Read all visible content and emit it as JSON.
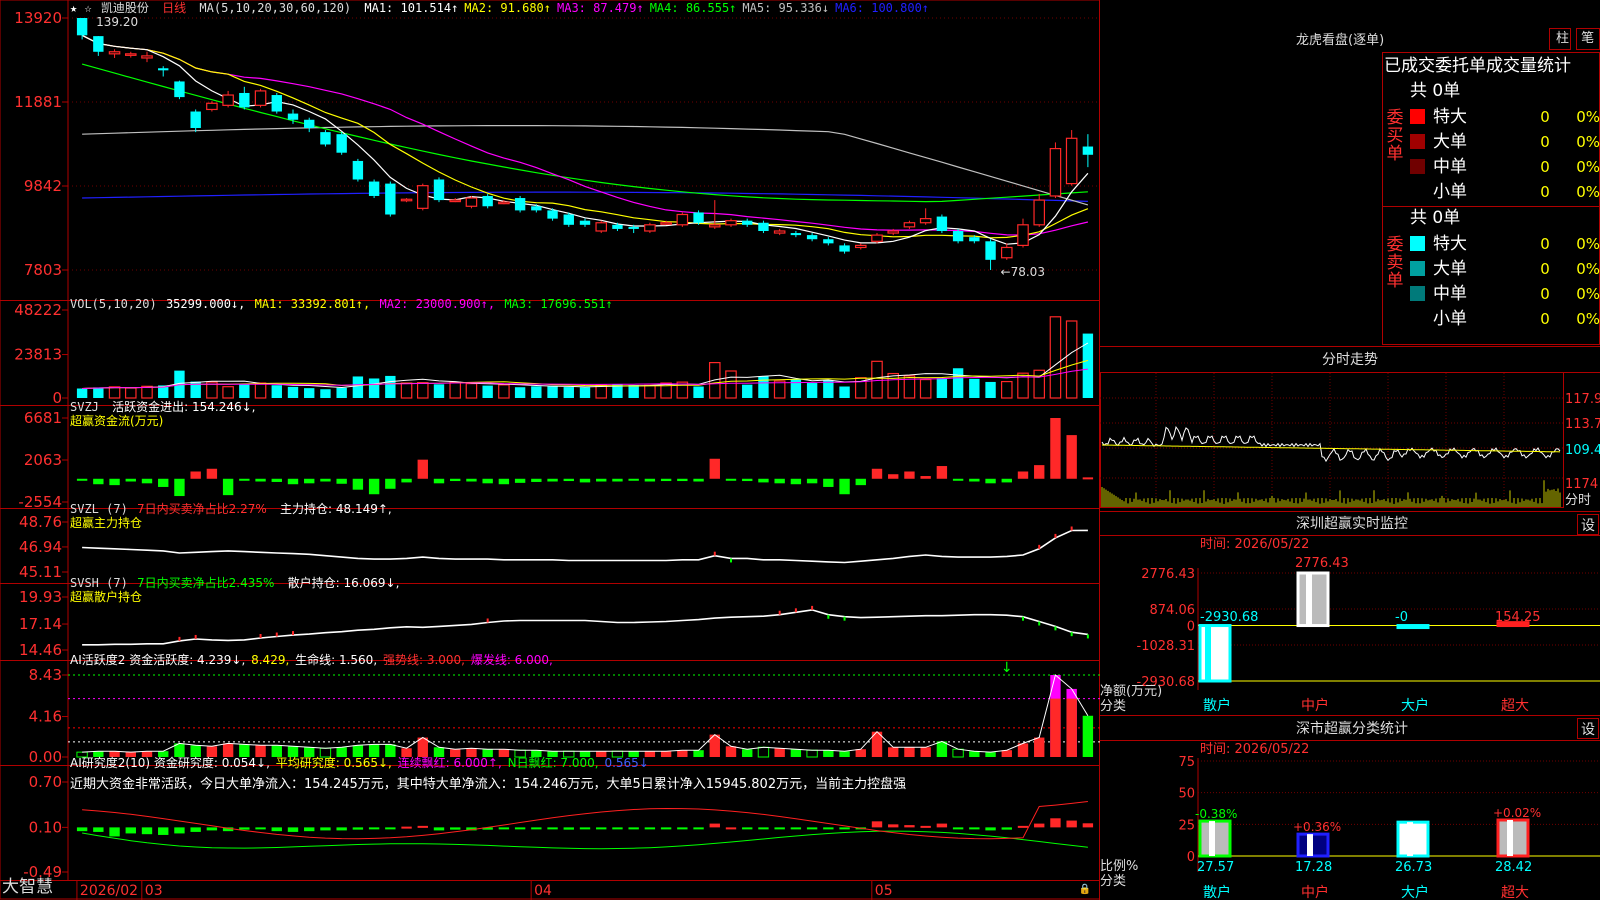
{
  "stock": {
    "name": "凯迪股份",
    "period": "日线",
    "top_marks": "★ ☆"
  },
  "colors": {
    "up": "#ff2828",
    "down": "#00ffff",
    "ma1": "#ffffff",
    "ma2": "#ffff00",
    "ma3": "#ff00ff",
    "ma4": "#00ff00",
    "ma5": "#c0c0c0",
    "ma6": "#2020ff",
    "frame": "#b00000",
    "grid": "#700000"
  },
  "main": {
    "ma_label": "MA(5,10,20,30,60,120)",
    "ma_items": [
      {
        "text": "MA1: 101.514↑",
        "color": "#ffffff"
      },
      {
        "text": "MA2: 91.680↑",
        "color": "#ffff00"
      },
      {
        "text": "MA3: 87.479↑",
        "color": "#ff00ff"
      },
      {
        "text": "MA4: 86.555↑",
        "color": "#00ff00"
      },
      {
        "text": "MA5: 95.336↓",
        "color": "#c0c0c0"
      },
      {
        "text": "MA6: 100.800↑",
        "color": "#2020ff"
      }
    ],
    "y_ticks": [
      "13920",
      "11881",
      "9842",
      "7803"
    ],
    "high_label": "139.20",
    "low_label": "←78.03"
  },
  "vol": {
    "label": "VOL(5,10,20)",
    "value": "35299.000↓,",
    "ma1": "MA1: 33392.801↑,",
    "ma2": "MA2: 23000.900↑,",
    "ma3": "MA3: 17696.551↑",
    "y_ticks": [
      "48222",
      "23813",
      "0"
    ]
  },
  "svzj": {
    "label": "SVZJ",
    "text": "活跃资金进出: 154.246↓,",
    "sub": "超赢资金流(万元)",
    "y_ticks": [
      "6681",
      "2063",
      "-2554"
    ]
  },
  "svzl": {
    "label": "SVZL (7)",
    "text1": "7日内买卖净占比2.27%",
    "text2": "主力持仓: 48.149↑,",
    "sub": "超赢主力持仓",
    "y_ticks": [
      "48.76",
      "46.94",
      "45.11"
    ]
  },
  "svsh": {
    "label": "SVSH (7)",
    "text1": "7日内买卖净占比2.435%",
    "text2": "散户持仓: 16.069↓,",
    "sub": "超赢散户持仓",
    "y_ticks": [
      "19.93",
      "17.14",
      "14.46"
    ]
  },
  "ai1": {
    "label": "AI活跃度2 资金活跃度: 4.239↓,",
    "v2": "8.429,",
    "v3": "生命线: 1.560,",
    "v4": "强势线: 3.000,",
    "v5": "爆发线: 6.000,",
    "y_ticks": [
      "8.43",
      "4.16",
      "0.00"
    ]
  },
  "ai2": {
    "label": "AI研究度2(10) 资金研究度: 0.054↓,",
    "v2": "平均研究度: 0.565↓,",
    "v3": "连续飘红: 6.000↑,",
    "v4": "N日飘红: 7.000,",
    "v5": "0.565↓",
    "text": "近期大资金非常活跃，今日大单净流入：154.245万元，其中特大单净流入：154.246万元，大单5日累计净入15945.802万元，当前主力控盘强",
    "y_ticks": [
      "0.70",
      "0.10",
      "-0.49"
    ]
  },
  "bottom": {
    "logo": "大智慧",
    "dates": [
      "2026/02",
      "03",
      "04",
      "05"
    ]
  },
  "dragon": {
    "title": "龙虎看盘(逐单)",
    "tab1": "柱",
    "tab2": "笔",
    "header": "已成交委托单成交量统计",
    "buy_label": "委买单",
    "sell_label": "委卖单",
    "buy_total": "共 0单",
    "sell_total": "共 0单",
    "buy_rows": [
      {
        "name": "特大",
        "val": "0",
        "pct": "0%",
        "color": "#ff0000"
      },
      {
        "name": "大单",
        "val": "0",
        "pct": "0%",
        "color": "#a00000"
      },
      {
        "name": "中单",
        "val": "0",
        "pct": "0%",
        "color": "#700000"
      },
      {
        "name": "小单",
        "val": "0",
        "pct": "0%",
        "color": ""
      }
    ],
    "sell_rows": [
      {
        "name": "特大",
        "val": "0",
        "pct": "0%",
        "color": "#00ffff"
      },
      {
        "name": "大单",
        "val": "0",
        "pct": "0%",
        "color": "#00a0a0"
      },
      {
        "name": "中单",
        "val": "0",
        "pct": "0%",
        "color": "#007a7a"
      },
      {
        "name": "小单",
        "val": "0",
        "pct": "0%",
        "color": ""
      }
    ]
  },
  "intraday": {
    "title": "分时走势",
    "ticks": [
      "117.9",
      "113.7",
      "109.4"
    ],
    "vol_tick": "1174",
    "unit": "分时"
  },
  "monitor": {
    "title": "深圳超赢实时监控",
    "btn": "设",
    "time": "时间: 2026/05/22",
    "y_ticks": [
      "2776.43",
      "874.06",
      "0",
      "-1028.31",
      "-2930.68"
    ],
    "unit1": "净额(万元)",
    "unit2": "分类",
    "categories": [
      "散户",
      "中户",
      "大户",
      "超大"
    ],
    "values": [
      -2930.68,
      2776.43,
      0,
      154.25
    ],
    "value_labels": [
      "-2930.68",
      "2776.43",
      "-0",
      "154.25"
    ]
  },
  "classify": {
    "title": "深市超赢分类统计",
    "btn": "设",
    "time": "时间: 2026/05/22",
    "y_ticks": [
      "75",
      "50",
      "25",
      "0"
    ],
    "unit1": "比例%",
    "unit2": "分类",
    "categories": [
      "散户",
      "中户",
      "大户",
      "超大"
    ],
    "values": [
      27.57,
      17.28,
      26.73,
      28.42
    ],
    "top_labels": [
      "-0.38%",
      "+0.36%",
      "",
      "+0.02%"
    ],
    "value_labels": [
      "27.57",
      "17.28",
      "26.73",
      "28.42"
    ]
  },
  "chart_data": [
    {
      "type": "candlestick",
      "title": "凯迪股份 日线",
      "ylim": [
        78.03,
        139.2
      ],
      "x_ticks": [
        "2026/02",
        "03",
        "04",
        "05"
      ],
      "ohlc": [
        [
          139.2,
          135.0,
          138.0,
          134.0
        ],
        [
          134.8,
          131.0,
          134.8,
          130.0
        ],
        [
          130.5,
          131.0,
          131.6,
          129.5
        ],
        [
          130.5,
          130.5,
          131.0,
          129.6
        ],
        [
          129.5,
          130.0,
          131.0,
          128.5
        ],
        [
          127.0,
          126.5,
          127.5,
          125.0
        ],
        [
          123.8,
          120.0,
          124.0,
          119.5
        ],
        [
          116.5,
          112.5,
          117.0,
          111.5
        ],
        [
          117.0,
          118.5,
          119.0,
          116.5
        ],
        [
          118.0,
          120.5,
          121.5,
          117.5
        ],
        [
          121.0,
          117.5,
          122.5,
          117.0
        ],
        [
          118.0,
          121.5,
          122.0,
          117.5
        ],
        [
          120.5,
          116.5,
          121.0,
          116.0
        ],
        [
          116.0,
          114.5,
          117.0,
          113.5
        ],
        [
          114.5,
          112.5,
          115.0,
          111.5
        ],
        [
          111.5,
          108.5,
          112.0,
          108.0
        ],
        [
          111.0,
          106.5,
          111.5,
          106.0
        ],
        [
          104.5,
          100.0,
          105.0,
          99.5
        ],
        [
          99.5,
          96.0,
          100.0,
          95.5
        ],
        [
          99.0,
          91.5,
          99.5,
          91.0
        ],
        [
          95.0,
          95.2,
          95.5,
          94.5
        ],
        [
          93.0,
          98.5,
          99.0,
          92.5
        ],
        [
          100.0,
          95.0,
          100.5,
          94.5
        ],
        [
          95.0,
          95.0,
          95.5,
          94.5
        ],
        [
          93.5,
          95.5,
          96.0,
          93.0
        ],
        [
          96.0,
          93.5,
          96.5,
          93.0
        ],
        [
          94.5,
          94.5,
          95.0,
          94.0
        ],
        [
          95.5,
          92.5,
          96.0,
          92.0
        ],
        [
          93.5,
          92.5,
          94.0,
          92.0
        ],
        [
          92.5,
          90.5,
          93.0,
          90.0
        ],
        [
          91.5,
          89.0,
          92.0,
          88.5
        ],
        [
          90.0,
          89.0,
          90.5,
          88.5
        ],
        [
          87.5,
          89.5,
          90.0,
          87.0
        ],
        [
          89.0,
          88.0,
          89.5,
          87.5
        ],
        [
          88.5,
          88.0,
          89.0,
          87.0
        ],
        [
          87.5,
          89.0,
          89.5,
          87.0
        ],
        [
          89.5,
          89.5,
          90.0,
          89.0
        ],
        [
          89.0,
          91.5,
          92.0,
          88.5
        ],
        [
          92.0,
          89.5,
          92.5,
          89.0
        ],
        [
          88.5,
          89.0,
          95.0,
          88.0
        ],
        [
          89.0,
          90.0,
          90.5,
          88.5
        ],
        [
          90.0,
          89.0,
          90.5,
          88.5
        ],
        [
          89.5,
          87.5,
          90.0,
          87.0
        ],
        [
          87.0,
          87.5,
          88.0,
          86.5
        ],
        [
          87.0,
          86.5,
          87.5,
          86.0
        ],
        [
          86.5,
          85.5,
          87.0,
          85.0
        ],
        [
          85.5,
          84.5,
          86.0,
          84.0
        ],
        [
          84.0,
          82.5,
          84.5,
          82.0
        ],
        [
          83.5,
          84.0,
          84.5,
          83.0
        ],
        [
          85.0,
          86.5,
          87.0,
          84.5
        ],
        [
          87.0,
          87.5,
          88.0,
          86.5
        ],
        [
          88.5,
          89.5,
          90.0,
          88.0
        ],
        [
          89.5,
          90.5,
          93.0,
          89.0
        ],
        [
          91.0,
          87.5,
          91.5,
          87.0
        ],
        [
          87.5,
          85.0,
          88.0,
          84.5
        ],
        [
          86.0,
          85.0,
          86.5,
          84.5
        ],
        [
          85.0,
          80.5,
          85.5,
          78.03
        ],
        [
          81.0,
          83.5,
          84.5,
          80.5
        ],
        [
          84.0,
          89.0,
          90.5,
          83.5
        ],
        [
          89.0,
          95.0,
          96.5,
          88.5
        ],
        [
          96.0,
          107.5,
          109.0,
          95.5
        ],
        [
          99.0,
          110.0,
          112.0,
          98.5
        ],
        [
          108.0,
          106.0,
          111.0,
          103.0
        ]
      ]
    },
    {
      "type": "bar",
      "title": "VOL(5,10,20)",
      "ylim": [
        0,
        48222
      ],
      "values": [
        5200,
        5800,
        6100,
        5500,
        6400,
        6900,
        15000,
        9000,
        8700,
        6200,
        7500,
        8200,
        7000,
        6100,
        5400,
        4800,
        5600,
        11800,
        10700,
        12100,
        8200,
        8400,
        7500,
        8600,
        7900,
        6800,
        7200,
        5900,
        6400,
        6300,
        6000,
        5900,
        7000,
        7400,
        7100,
        6900,
        8200,
        8700,
        6300,
        19400,
        14800,
        7300,
        11800,
        9300,
        10400,
        8200,
        9600,
        6300,
        11100,
        20100,
        13400,
        12100,
        10100,
        10900,
        16300,
        10500,
        8800,
        9000,
        13600,
        15200,
        44500,
        42200,
        35299
      ]
    },
    {
      "type": "bar",
      "title": "SVZJ 超赢资金流(万元)",
      "ylim": [
        -2554,
        6681
      ],
      "values": [
        -150,
        -600,
        -700,
        -300,
        -500,
        -900,
        -1900,
        800,
        1100,
        -1800,
        -200,
        -300,
        -350,
        -600,
        -500,
        -300,
        -550,
        -1200,
        -1700,
        -1100,
        -400,
        2100,
        -500,
        -250,
        -300,
        -500,
        -600,
        -450,
        -350,
        -300,
        -250,
        -400,
        -300,
        -300,
        -200,
        -300,
        -250,
        -250,
        -300,
        2200,
        -200,
        -250,
        -400,
        -500,
        -600,
        -500,
        -900,
        -1700,
        -700,
        1100,
        500,
        800,
        300,
        1400,
        -200,
        -300,
        -500,
        -400,
        800,
        1500,
        6681,
        4800,
        154
      ]
    },
    {
      "type": "line",
      "title": "SVZL 超赢主力持仓",
      "ylim": [
        45.11,
        48.76
      ],
      "values": [
        46.9,
        46.85,
        46.8,
        46.75,
        46.7,
        46.65,
        46.5,
        46.55,
        46.6,
        46.65,
        46.6,
        46.55,
        46.5,
        46.45,
        46.4,
        46.3,
        46.2,
        46.1,
        46.05,
        46.05,
        46.1,
        46.2,
        46.1,
        46.05,
        46.05,
        46.05,
        46.0,
        46.0,
        46.0,
        46.0,
        45.95,
        45.95,
        45.95,
        45.95,
        45.95,
        45.95,
        45.95,
        46.0,
        46.0,
        46.3,
        46.1,
        46.1,
        46.0,
        46.0,
        45.95,
        45.9,
        45.85,
        45.8,
        45.9,
        46.0,
        46.1,
        46.25,
        46.35,
        46.25,
        46.2,
        46.2,
        46.2,
        46.25,
        46.35,
        46.8,
        47.6,
        48.14,
        48.149
      ]
    },
    {
      "type": "line",
      "title": "SVSH 超赢散户持仓",
      "ylim": [
        14.46,
        19.93
      ],
      "values": [
        15.0,
        15.0,
        15.05,
        15.05,
        15.1,
        15.1,
        15.4,
        15.6,
        15.5,
        15.45,
        15.5,
        15.7,
        15.85,
        16.0,
        16.1,
        16.25,
        16.35,
        16.5,
        16.6,
        16.75,
        16.85,
        16.8,
        16.9,
        17.0,
        17.1,
        17.3,
        17.45,
        17.5,
        17.5,
        17.5,
        17.5,
        17.5,
        17.4,
        17.3,
        17.3,
        17.35,
        17.4,
        17.5,
        17.6,
        17.75,
        17.85,
        17.9,
        17.95,
        18.1,
        18.35,
        18.6,
        18.1,
        17.9,
        17.8,
        17.85,
        17.9,
        17.95,
        18.0,
        18.0,
        18.05,
        18.1,
        18.1,
        18.05,
        17.9,
        17.4,
        16.9,
        16.3,
        16.069
      ]
    },
    {
      "type": "bar",
      "title": "AI活跃度2",
      "ylim": [
        0,
        8.43
      ],
      "values": [
        0.5,
        0.6,
        0.6,
        0.5,
        0.6,
        0.6,
        1.4,
        1.2,
        1.1,
        1.4,
        1.3,
        1.2,
        1.2,
        1.1,
        1.0,
        0.9,
        1.0,
        1.2,
        1.3,
        1.3,
        0.9,
        2.0,
        1.0,
        0.8,
        0.9,
        0.8,
        0.8,
        0.7,
        0.7,
        0.6,
        0.6,
        0.6,
        0.6,
        0.6,
        0.6,
        0.6,
        0.6,
        0.7,
        0.7,
        2.3,
        1.1,
        0.8,
        1.0,
        0.9,
        0.8,
        0.7,
        0.7,
        0.6,
        0.8,
        2.6,
        1.0,
        1.0,
        1.0,
        1.6,
        0.8,
        0.6,
        0.5,
        0.7,
        1.4,
        2.0,
        8.429,
        7.0,
        4.239
      ]
    },
    {
      "type": "bar",
      "title": "AI研究度2(10)",
      "ylim": [
        -0.49,
        0.7
      ],
      "values": [
        -0.05,
        -0.06,
        -0.12,
        -0.08,
        -0.09,
        -0.1,
        -0.08,
        -0.06,
        -0.04,
        -0.05,
        -0.03,
        -0.02,
        -0.05,
        -0.06,
        -0.05,
        -0.04,
        -0.04,
        -0.03,
        -0.02,
        -0.01,
        0.01,
        0.02,
        -0.04,
        -0.03,
        -0.04,
        -0.03,
        -0.02,
        -0.02,
        -0.02,
        -0.02,
        -0.03,
        -0.02,
        -0.02,
        -0.02,
        -0.02,
        -0.02,
        -0.02,
        -0.01,
        -0.01,
        0.05,
        0.0,
        -0.01,
        -0.02,
        -0.02,
        -0.02,
        -0.02,
        -0.02,
        -0.02,
        -0.01,
        0.08,
        0.04,
        0.03,
        0.02,
        0.05,
        -0.01,
        -0.02,
        -0.04,
        -0.03,
        0.02,
        0.05,
        0.12,
        0.09,
        0.054
      ]
    },
    {
      "type": "line",
      "title": "分时走势",
      "ylim": [
        105.0,
        117.9
      ]
    },
    {
      "type": "bar",
      "title": "深圳超赢实时监控",
      "categories": [
        "散户",
        "中户",
        "大户",
        "超大"
      ],
      "values": [
        -2930.68,
        2776.43,
        0,
        154.25
      ],
      "ylabel": "净额(万元)",
      "ylim": [
        -2930.68,
        2776.43
      ]
    },
    {
      "type": "bar",
      "title": "深市超赢分类统计",
      "categories": [
        "散户",
        "中户",
        "大户",
        "超大"
      ],
      "values": [
        27.57,
        17.28,
        26.73,
        28.42
      ],
      "ylabel": "比例%",
      "ylim": [
        0,
        75
      ]
    }
  ]
}
